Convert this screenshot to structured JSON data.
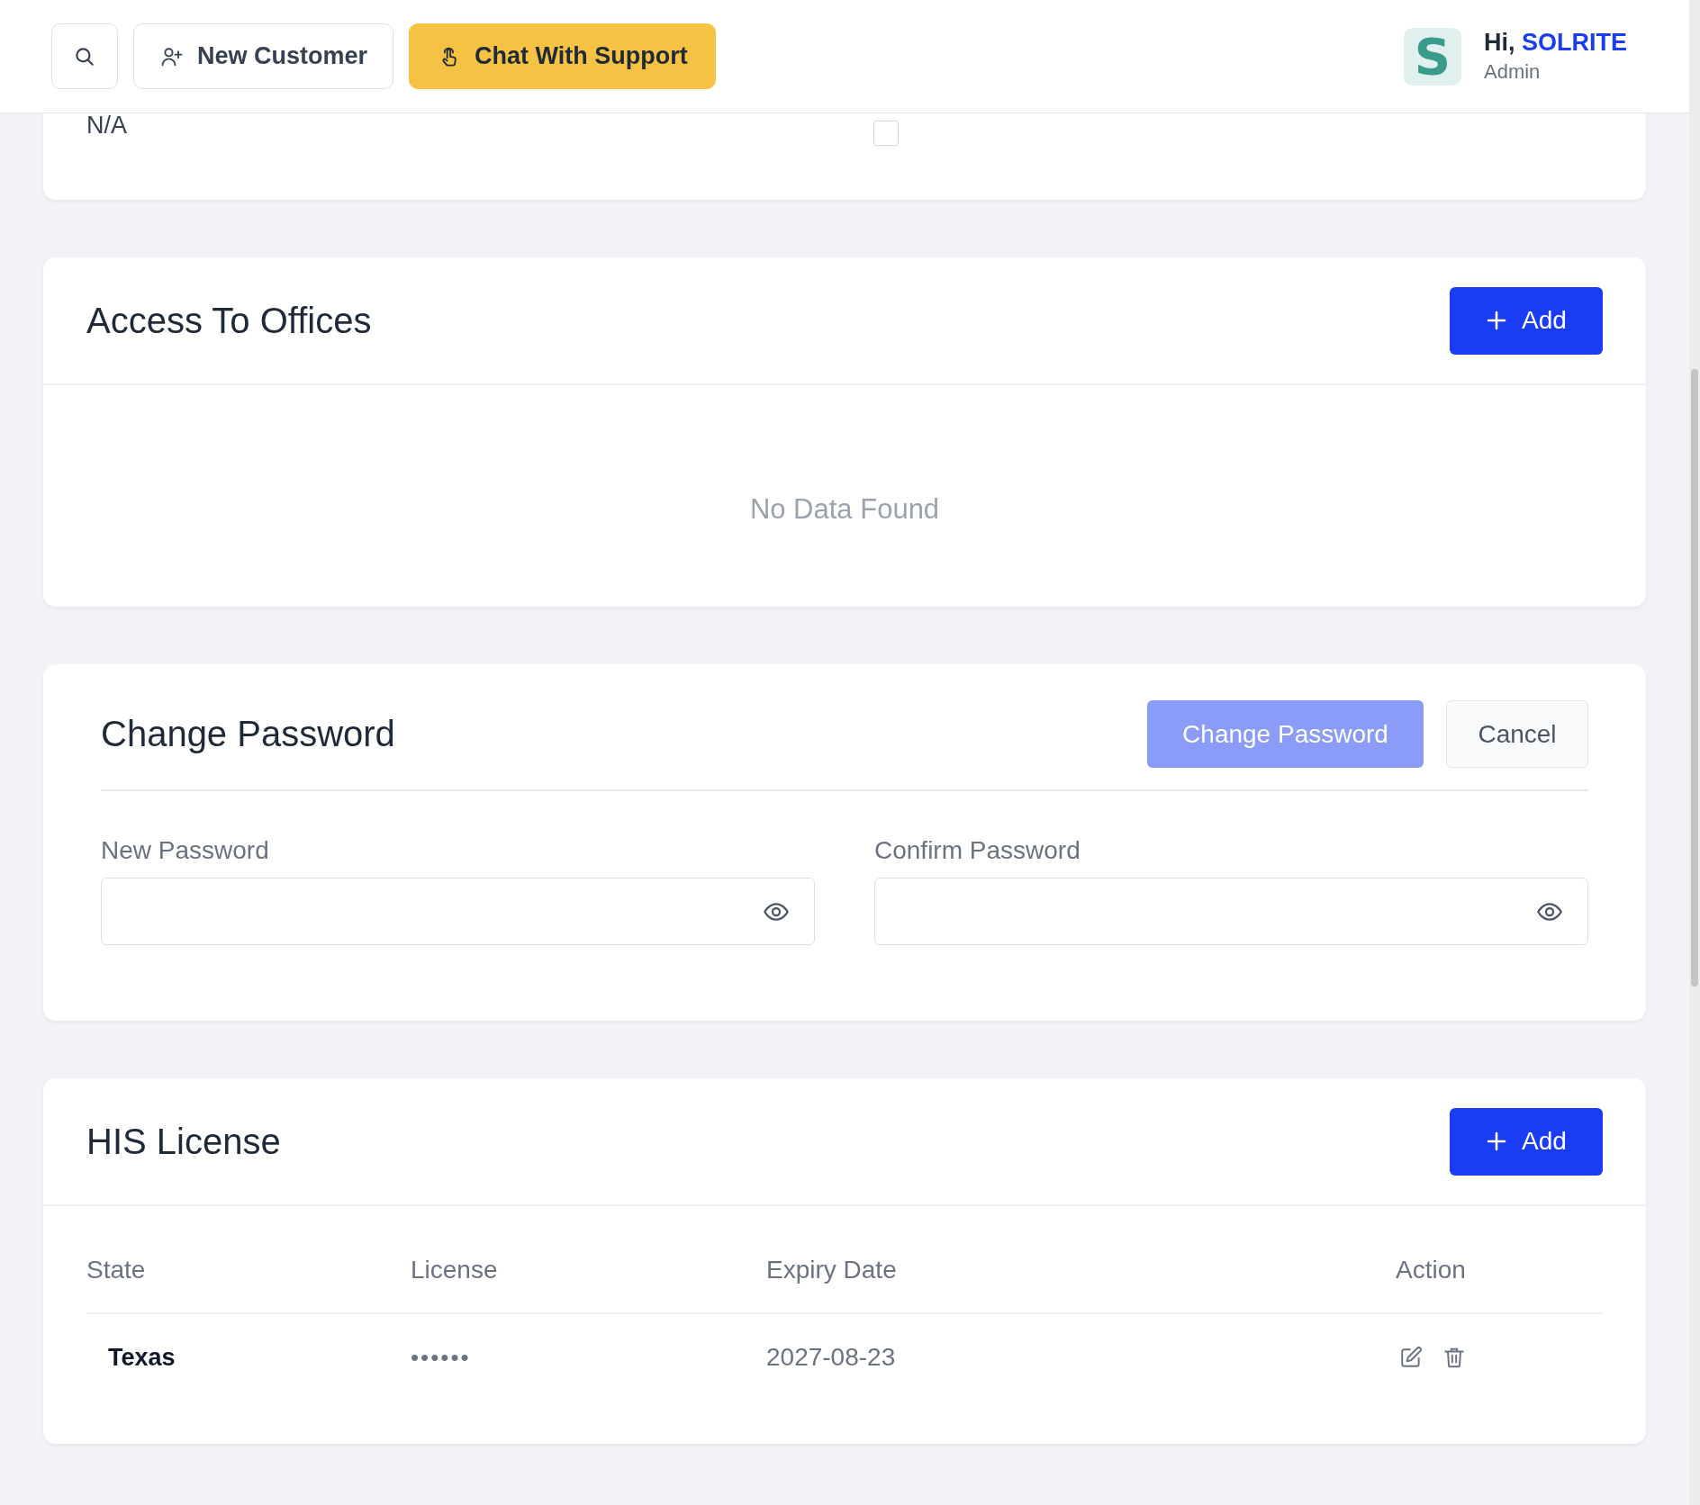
{
  "topbar": {
    "new_customer": "New Customer",
    "chat_support": "Chat With Support",
    "avatar_letter": "S",
    "greeting": "Hi,",
    "user_name": "SOLRITE",
    "role": "Admin"
  },
  "profile_card": {
    "fields": [
      {
        "kind": "text",
        "value": "N/A"
      },
      {
        "kind": "checkbox",
        "checked": false
      }
    ]
  },
  "offices": {
    "title": "Access To Offices",
    "add_label": "Add",
    "empty_text": "No Data Found"
  },
  "change_password": {
    "title": "Change Password",
    "submit": "Change Password",
    "submit_disabled": true,
    "cancel": "Cancel",
    "fields": [
      {
        "label": "New Password"
      },
      {
        "label": "Confirm Password"
      }
    ]
  },
  "license": {
    "title": "HIS License",
    "add_label": "Add",
    "columns": [
      "State",
      "License",
      "Expiry Date",
      "Action"
    ],
    "rows": [
      {
        "state": "Texas",
        "license": "••••••",
        "expiry": "2027-08-23"
      }
    ]
  }
}
